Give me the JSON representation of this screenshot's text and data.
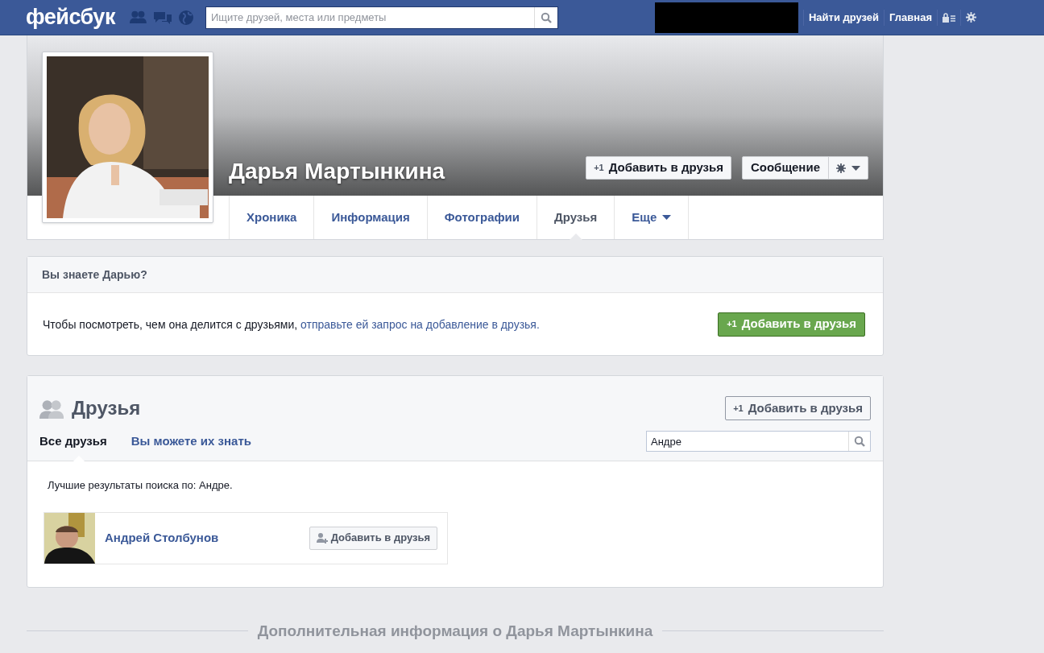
{
  "top_bar": {
    "logo": "фейсбук",
    "search": {
      "placeholder": "Ищите друзей, места или предметы"
    },
    "links": [
      "Найти друзей",
      "Главная"
    ]
  },
  "profile": {
    "name": "Дарья Мартынкина",
    "actions": [
      {
        "kind": "add",
        "icon_text": "+1",
        "label": "Добавить в друзья"
      },
      {
        "kind": "message",
        "label": "Сообщение"
      }
    ],
    "tabs": [
      {
        "label": "Хроника",
        "selected": false
      },
      {
        "label": "Информация",
        "selected": false
      },
      {
        "label": "Фотографии",
        "selected": false
      },
      {
        "label": "Друзья",
        "selected": true
      },
      {
        "label": "Еще",
        "selected": false,
        "dropdown": true
      }
    ]
  },
  "know_card": {
    "title": "Вы знаете Дарью?",
    "text": "Чтобы посмотреть, чем она делится с друзьями, ",
    "link": "отправьте ей запрос на добавление в друзья.",
    "button": {
      "icon_text": "+1",
      "label": "Добавить в друзья"
    }
  },
  "friends": {
    "title": "Друзья",
    "button": {
      "icon_text": "+1",
      "label": "Добавить в друзья"
    },
    "tabs": [
      {
        "label": "Все друзья",
        "selected": true
      },
      {
        "label": "Вы можете их знать",
        "selected": false
      }
    ],
    "search": {
      "value": "Андре"
    },
    "results_text": "Лучшие результаты поиска по: Андре.",
    "people": [
      {
        "name": "Андрей Столбунов",
        "button": "Добавить в друзья"
      }
    ]
  },
  "footer": {
    "text": "Дополнительная информация о Дарья Мартынкина"
  }
}
